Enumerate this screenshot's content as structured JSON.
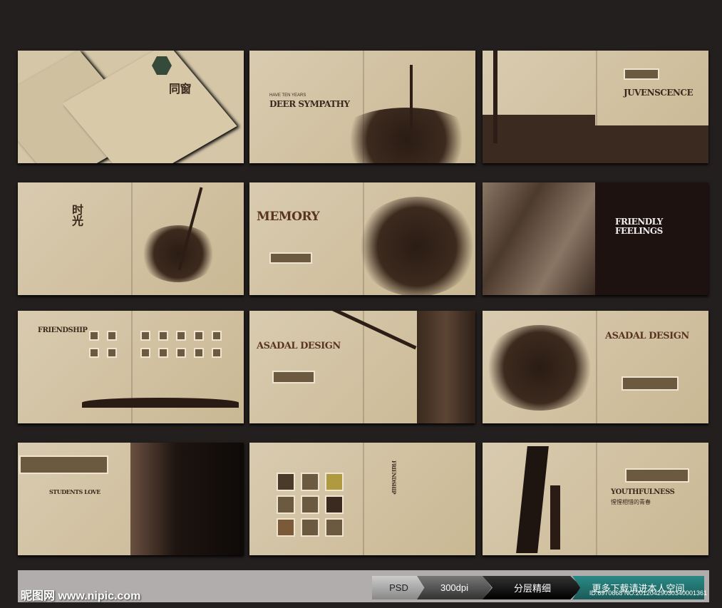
{
  "panels": [
    {
      "title": "同窗"
    },
    {
      "kicker": "HAVE TEN YEARS",
      "title": "DEER SYMPATHY"
    },
    {
      "title": "JUVENSCENCE"
    },
    {
      "title": "时光"
    },
    {
      "title": "MEMORY"
    },
    {
      "title": "FRIENDLY",
      "title2": "FEELINGS"
    },
    {
      "title": "FRIENDSHIP"
    },
    {
      "title": "ASADAL DESIGN"
    },
    {
      "title": "ASADAL DESIGN"
    },
    {
      "title": "STUDENTS LOVE"
    },
    {
      "title": "FRIENDSHIP"
    },
    {
      "title": "YOUTHFULNESS",
      "subtitle": "惺惺相惜的青春"
    }
  ],
  "footer": {
    "logo": "昵图网 www.nipic.com",
    "steps": [
      "PSD",
      "300dpi",
      "分层精细",
      "更多下载请进本人空间"
    ],
    "id": "ID:6970668 NO:20120429030340001361"
  }
}
